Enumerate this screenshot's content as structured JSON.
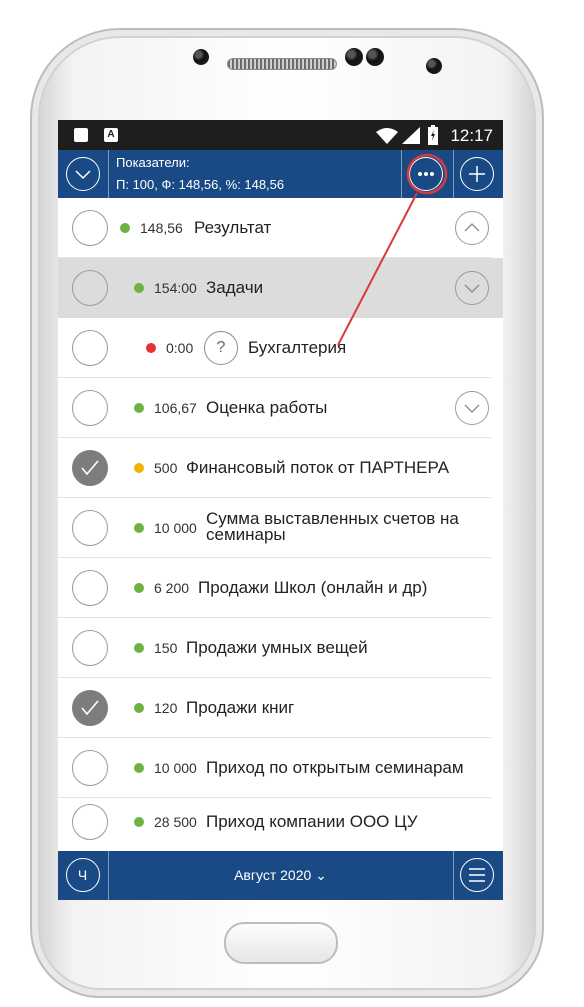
{
  "statusbar": {
    "time": "12:17",
    "icons": [
      "image-icon",
      "a-icon",
      "wifi-icon",
      "signal-icon",
      "battery-icon"
    ],
    "a_glyph": "A"
  },
  "header": {
    "title": "Показатели:",
    "summary": "П: 100, Ф: 148,56, %: 148,56",
    "icons": [
      "chevron-down-icon",
      "more-icon",
      "plus-icon"
    ]
  },
  "colors": {
    "brand": "#194a85",
    "green": "#6db33f",
    "red": "#e53232",
    "yellow": "#f0b400",
    "annotation": "#d93a3a"
  },
  "rows": [
    {
      "value": "148,56",
      "label": "Результат",
      "status": "green",
      "checked": false,
      "expander": "up"
    },
    {
      "value": "154:00",
      "label": "Задачи",
      "status": "green",
      "checked": false,
      "expander": "down"
    },
    {
      "value": "0:00",
      "label": "Бухгалтерия",
      "status": "red",
      "checked": false,
      "help": "?"
    },
    {
      "value": "106,67",
      "label": "Оценка работы",
      "status": "green",
      "checked": false,
      "expander": "down"
    },
    {
      "value": "500",
      "label": "Финансовый поток от ПАРТНЕРА",
      "status": "yellow",
      "checked": true
    },
    {
      "value": "10 000",
      "label": "Сумма выставленных счетов на семинары",
      "status": "green",
      "checked": false
    },
    {
      "value": "6 200",
      "label": "Продажи Школ (онлайн и др)",
      "status": "green",
      "checked": false
    },
    {
      "value": "150",
      "label": "Продажи умных вещей",
      "status": "green",
      "checked": false
    },
    {
      "value": "120",
      "label": "Продажи книг",
      "status": "green",
      "checked": true
    },
    {
      "value": "10 000",
      "label": "Приход по открытым семинарам",
      "status": "green",
      "checked": false
    },
    {
      "value": "28 500",
      "label": "Приход компании ООО ЦУ",
      "status": "green",
      "checked": false
    }
  ],
  "footer": {
    "left_glyph": "Ч",
    "month": "Август 2020 ⌄"
  }
}
